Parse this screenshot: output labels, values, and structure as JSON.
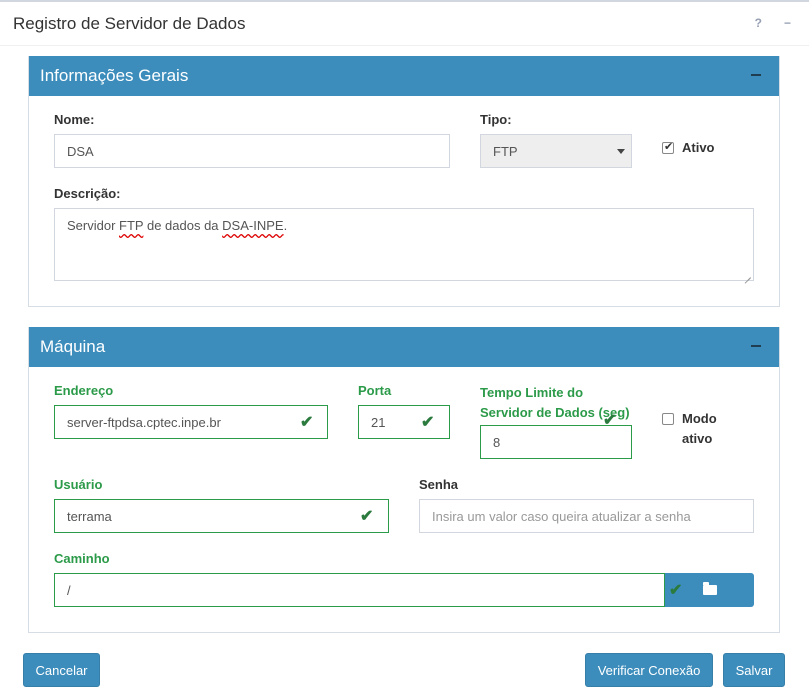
{
  "header": {
    "title": "Registro de Servidor de Dados",
    "help_label": "?",
    "minimize_label": "−"
  },
  "general": {
    "title": "Informações Gerais",
    "name_label": "Nome:",
    "name_value": "DSA",
    "type_label": "Tipo:",
    "type_value": "FTP",
    "active_label": "Ativo",
    "active_checked": true,
    "desc_label": "Descrição:",
    "desc_prefix": "Servidor ",
    "desc_ftp": "FTP",
    "desc_mid": " de dados da ",
    "desc_dsa": "DSA-INPE",
    "desc_suffix": "."
  },
  "machine": {
    "title": "Máquina",
    "address_label": "Endereço",
    "address_value": "server-ftpdsa.cptec.inpe.br",
    "port_label": "Porta",
    "port_value": "21",
    "timeout_label_1": "Tempo Limite do",
    "timeout_label_2": "Servidor de Dados (seg)",
    "timeout_value": "8",
    "active_mode_label_1": "Modo",
    "active_mode_label_2": "ativo",
    "active_mode_checked": false,
    "user_label": "Usuário",
    "user_value": "terrama",
    "password_label": "Senha",
    "password_placeholder": "Insira um valor caso queira atualizar a senha",
    "path_label": "Caminho",
    "path_value": "/"
  },
  "footer": {
    "cancel_label": "Cancelar",
    "verify_label": "Verificar Conexão",
    "save_label": "Salvar"
  }
}
